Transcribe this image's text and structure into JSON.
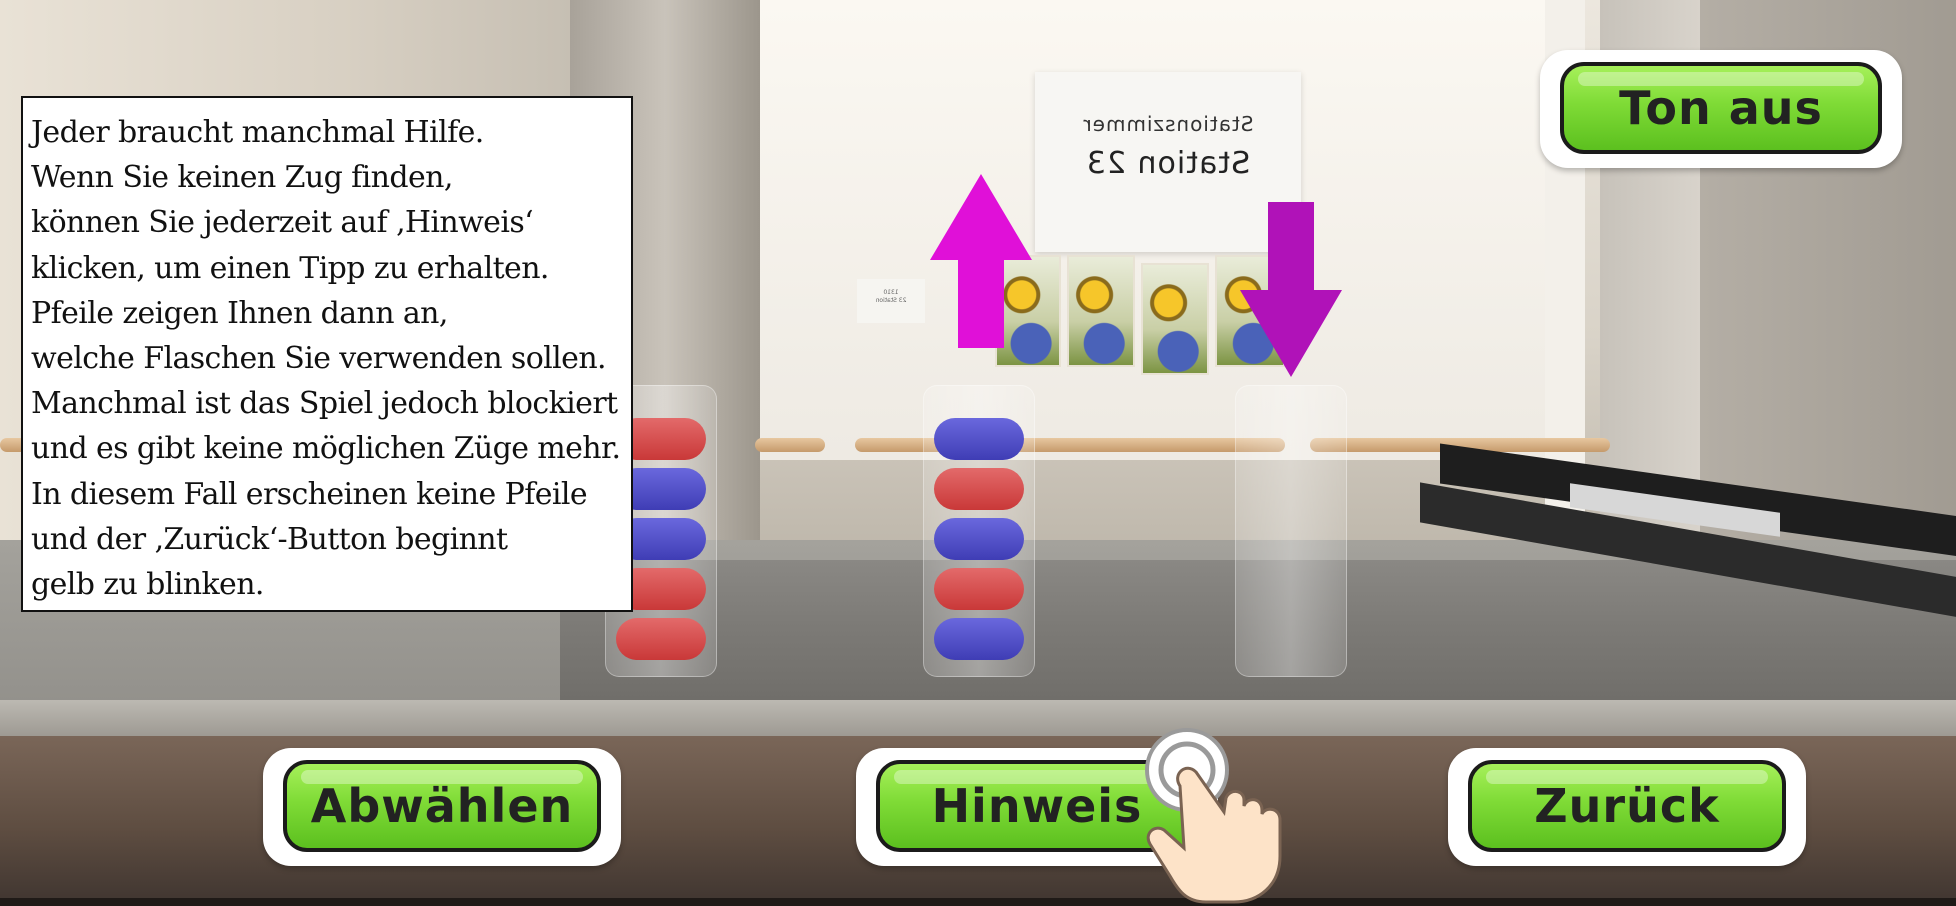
{
  "scene": {
    "sign": {
      "line1": "Stationszimmer",
      "line2": "Station 23"
    },
    "notice_lines": [
      "1310",
      "23 Station"
    ]
  },
  "colors": {
    "button_green": "#7fdb36",
    "button_border": "#1b1b1b",
    "arrow_magenta": "#e010d8",
    "arrow_purple": "#b012b8",
    "ball_red": "#d24848",
    "ball_blue": "#4f4dc8"
  },
  "tubes": [
    {
      "id": "left",
      "balls": [
        "red",
        "blue",
        "blue",
        "red",
        "red"
      ]
    },
    {
      "id": "middle",
      "balls": [
        "blue",
        "red",
        "blue",
        "red",
        "blue"
      ]
    },
    {
      "id": "right",
      "balls": []
    }
  ],
  "hint_arrows": {
    "up": {
      "icon": "arrow-up-icon",
      "tube": "middle"
    },
    "down": {
      "icon": "arrow-down-icon",
      "tube": "right"
    }
  },
  "tutorial": {
    "lines": [
      "Jeder braucht manchmal Hilfe.",
      "Wenn Sie keinen Zug finden,",
      "können Sie jederzeit auf ‚Hinweis‘",
      "klicken, um einen Tipp zu erhalten.",
      "Pfeile zeigen Ihnen dann an,",
      "welche Flaschen Sie verwenden sollen.",
      "Manchmal ist das Spiel jedoch blockiert",
      "und es gibt keine möglichen Züge mehr.",
      "In diesem Fall erscheinen keine Pfeile",
      "und der ‚Zurück‘-Button beginnt",
      "gelb zu blinken."
    ]
  },
  "buttons": {
    "sound": "Ton aus",
    "deselect": "Abwählen",
    "hint": "Hinweis",
    "back": "Zurück"
  },
  "pointer": {
    "icon": "tap-hand-icon",
    "target": "hint"
  }
}
